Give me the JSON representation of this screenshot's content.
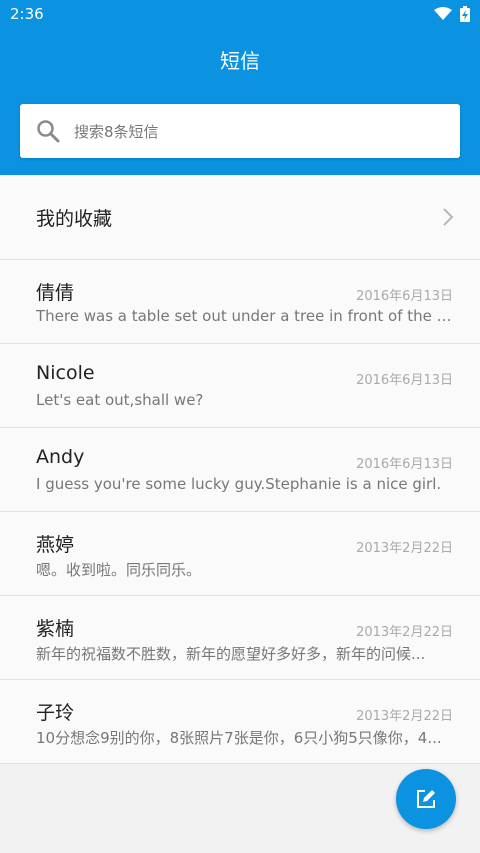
{
  "status_bar": {
    "time": "2:36"
  },
  "header": {
    "title": "短信"
  },
  "search": {
    "placeholder": "搜索8条短信"
  },
  "favorites": {
    "label": "我的收藏"
  },
  "conversations": [
    {
      "name": "倩倩",
      "date": "2016年6月13日",
      "preview": "There was a table set out under a tree in front of the ho..."
    },
    {
      "name": "Nicole",
      "date": "2016年6月13日",
      "preview": "Let's eat out,shall we?"
    },
    {
      "name": "Andy",
      "date": "2016年6月13日",
      "preview": "I guess you're some lucky guy.Stephanie is a nice girl."
    },
    {
      "name": "燕婷",
      "date": "2013年2月22日",
      "preview": "嗯。收到啦。同乐同乐。"
    },
    {
      "name": "紫楠",
      "date": "2013年2月22日",
      "preview": "新年的祝福数不胜数，新年的愿望好多好多，新年的问候..."
    },
    {
      "name": "子玲",
      "date": "2013年2月22日",
      "preview": "10分想念9别的你，8张照片7张是你，6只小狗5只像你，4..."
    }
  ],
  "colors": {
    "accent": "#0b93e1"
  },
  "icons": {
    "search": "search-icon",
    "chevron": "chevron-right-icon",
    "compose": "compose-icon",
    "wifi": "wifi-icon",
    "battery": "battery-icon"
  }
}
